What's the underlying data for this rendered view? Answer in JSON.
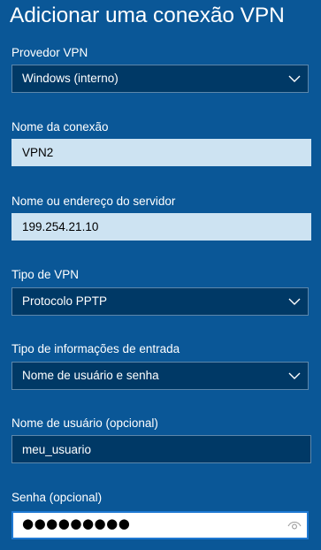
{
  "title": "Adicionar uma conexão VPN",
  "provider": {
    "label": "Provedor VPN",
    "value": "Windows (interno)"
  },
  "connection_name": {
    "label": "Nome da conexão",
    "value": "VPN2"
  },
  "server": {
    "label": "Nome ou endereço do servidor",
    "value": "199.254.21.10"
  },
  "vpn_type": {
    "label": "Tipo de VPN",
    "value": "Protocolo PPTP"
  },
  "signin_type": {
    "label": "Tipo de informações de entrada",
    "value": "Nome de usuário e senha"
  },
  "username": {
    "label": "Nome de usuário (opcional)",
    "value": "meu_usuario"
  },
  "password": {
    "label": "Senha (opcional)",
    "masked_value": "●●●●●●●●●",
    "reveal_icon": "eye-icon"
  },
  "colors": {
    "background": "#0a5797",
    "dark_field": "#003966",
    "light_field": "#cde3f2",
    "focus_border": "#1e78d2"
  }
}
